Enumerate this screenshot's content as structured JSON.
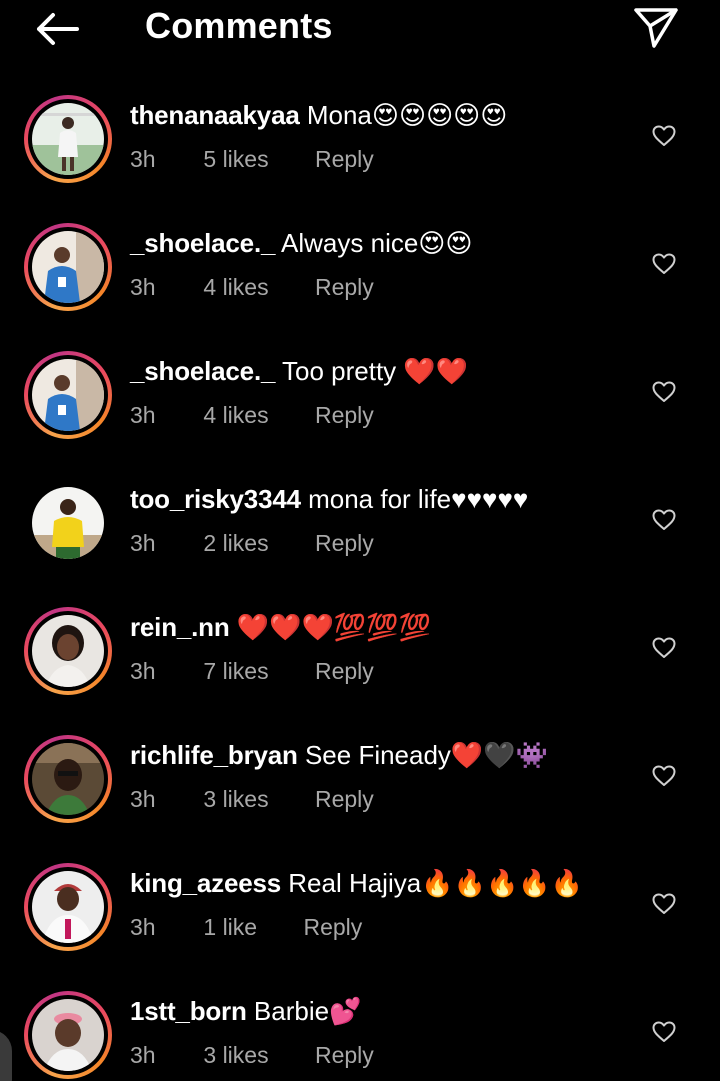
{
  "header": {
    "title": "Comments",
    "back_icon": "arrow-left-icon",
    "share_icon": "paper-plane-send-icon"
  },
  "colors": {
    "background": "#000000",
    "text": "#ffffff",
    "meta": "#a8a8a8",
    "story_ring_start": "#f7a34b",
    "story_ring_end": "#c13584"
  },
  "comments": [
    {
      "username": "thenanaakyaa",
      "text": "Mona😍😍😍😍😍",
      "time": "3h",
      "likes": "5 likes",
      "reply": "Reply",
      "avatar": "avatar-thenanaakyaa",
      "story_ring": true
    },
    {
      "username": "_shoelace._",
      "text": "Always nice😍😍",
      "time": "3h",
      "likes": "4 likes",
      "reply": "Reply",
      "avatar": "avatar-shoelace",
      "story_ring": true
    },
    {
      "username": "_shoelace._",
      "text": "Too pretty ❤️❤️",
      "time": "3h",
      "likes": "4 likes",
      "reply": "Reply",
      "avatar": "avatar-shoelace",
      "story_ring": true
    },
    {
      "username": "too_risky3344",
      "text": "mona for life♥♥♥♥♥",
      "time": "3h",
      "likes": "2 likes",
      "reply": "Reply",
      "avatar": "avatar-too-risky",
      "story_ring": false
    },
    {
      "username": "rein_.nn",
      "text": "❤️❤️❤️💯💯💯",
      "time": "3h",
      "likes": "7 likes",
      "reply": "Reply",
      "avatar": "avatar-rein",
      "story_ring": true
    },
    {
      "username": "richlife_bryan",
      "text": "See Fineady❤️🖤👾",
      "time": "3h",
      "likes": "3 likes",
      "reply": "Reply",
      "avatar": "avatar-richlife-bryan",
      "story_ring": true
    },
    {
      "username": "king_azeess",
      "text": "Real Hajiya🔥🔥🔥🔥🔥",
      "time": "3h",
      "likes": "1 like",
      "reply": "Reply",
      "avatar": "avatar-king-azeess",
      "story_ring": true
    },
    {
      "username": "1stt_born",
      "text": "Barbie💕",
      "time": "3h",
      "likes": "3 likes",
      "reply": "Reply",
      "avatar": "avatar-1stt-born",
      "story_ring": true
    }
  ]
}
